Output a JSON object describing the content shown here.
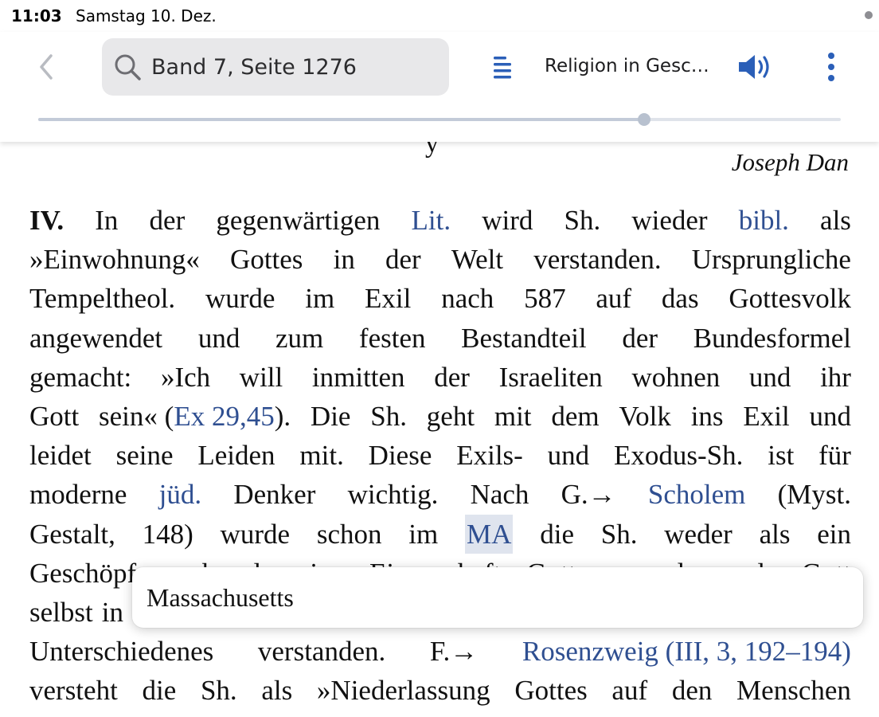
{
  "status_bar": {
    "time": "11:03",
    "date": "Samstag 10. Dez."
  },
  "toolbar": {
    "back_icon": "chevron-left-icon",
    "search": {
      "icon": "search-icon",
      "value": "Band 7, Seite 1276"
    },
    "toc_icon": "list-icon",
    "book_title": "Religion in Gesc…",
    "speaker_icon": "speaker-icon",
    "more_icon": "more-vertical-icon",
    "progress": 0.755
  },
  "page": {
    "cutoff_text": "y",
    "author": "Joseph Dan",
    "lines": [
      [
        {
          "text": "IV.",
          "type": "bold"
        },
        {
          "text": "In",
          "type": "text"
        },
        {
          "text": "der",
          "type": "text"
        },
        {
          "text": "gegenwärtigen",
          "type": "text"
        },
        {
          "text": "Lit.",
          "type": "link"
        },
        {
          "text": "wird",
          "type": "text"
        },
        {
          "text": "Sh.",
          "type": "text"
        },
        {
          "text": "wieder",
          "type": "text"
        },
        {
          "text": "bibl.",
          "type": "link"
        },
        {
          "text": "als",
          "type": "text"
        }
      ],
      [
        {
          "text": "»Einwohnung«",
          "type": "text"
        },
        {
          "text": "Gottes",
          "type": "text"
        },
        {
          "text": "in",
          "type": "text"
        },
        {
          "text": "der",
          "type": "text"
        },
        {
          "text": "Welt",
          "type": "text"
        },
        {
          "text": "verstanden.",
          "type": "text"
        },
        {
          "text": "Ursprungliche",
          "type": "text"
        }
      ],
      [
        {
          "text": "Tempeltheol.",
          "type": "text"
        },
        {
          "text": "wurde",
          "type": "text"
        },
        {
          "text": "im",
          "type": "text"
        },
        {
          "text": "Exil",
          "type": "text"
        },
        {
          "text": "nach",
          "type": "text"
        },
        {
          "text": "587",
          "type": "text"
        },
        {
          "text": "auf",
          "type": "text"
        },
        {
          "text": "das",
          "type": "text"
        },
        {
          "text": "Gottesvolk",
          "type": "text"
        }
      ],
      [
        {
          "text": "angewendet",
          "type": "text"
        },
        {
          "text": "und",
          "type": "text"
        },
        {
          "text": "zum",
          "type": "text"
        },
        {
          "text": "festen",
          "type": "text"
        },
        {
          "text": "Bestandteil",
          "type": "text"
        },
        {
          "text": "der",
          "type": "text"
        },
        {
          "text": "Bundesformel",
          "type": "text"
        }
      ],
      [
        {
          "text": "gemacht:",
          "type": "text"
        },
        {
          "text": "»Ich",
          "type": "text"
        },
        {
          "text": "will",
          "type": "text"
        },
        {
          "text": "inmitten",
          "type": "text"
        },
        {
          "text": "der",
          "type": "text"
        },
        {
          "text": "Israeliten",
          "type": "text"
        },
        {
          "text": "wohnen",
          "type": "text"
        },
        {
          "text": "und",
          "type": "text"
        },
        {
          "text": "ihr",
          "type": "text"
        }
      ],
      [
        {
          "text": "Gott",
          "type": "text"
        },
        {
          "text": "sein« (",
          "type": "text"
        },
        {
          "text": "Ex 29,45",
          "type": "link",
          "attach": true
        },
        {
          "text": ").",
          "type": "text",
          "attach": true
        },
        {
          "text": "Die",
          "type": "text"
        },
        {
          "text": "Sh.",
          "type": "text"
        },
        {
          "text": "geht",
          "type": "text"
        },
        {
          "text": "mit",
          "type": "text"
        },
        {
          "text": "dem",
          "type": "text"
        },
        {
          "text": "Volk",
          "type": "text"
        },
        {
          "text": "ins",
          "type": "text"
        },
        {
          "text": "Exil",
          "type": "text"
        },
        {
          "text": "und",
          "type": "text"
        }
      ],
      [
        {
          "text": "leidet",
          "type": "text"
        },
        {
          "text": "seine",
          "type": "text"
        },
        {
          "text": "Leiden",
          "type": "text"
        },
        {
          "text": "mit.",
          "type": "text"
        },
        {
          "text": "Diese",
          "type": "text"
        },
        {
          "text": "Exils-",
          "type": "text"
        },
        {
          "text": "und",
          "type": "text"
        },
        {
          "text": "Exodus-Sh.",
          "type": "text"
        },
        {
          "text": "ist",
          "type": "text"
        },
        {
          "text": "für",
          "type": "text"
        }
      ],
      [
        {
          "text": "moderne",
          "type": "text"
        },
        {
          "text": "jüd.",
          "type": "link"
        },
        {
          "text": "Denker",
          "type": "text"
        },
        {
          "text": "wichtig.",
          "type": "text"
        },
        {
          "text": "Nach",
          "type": "text"
        },
        {
          "text": "G.→",
          "type": "text"
        },
        {
          "text": "Scholem",
          "type": "link"
        },
        {
          "text": "(Myst.",
          "type": "text"
        }
      ],
      [
        {
          "text": "Gestalt,",
          "type": "text"
        },
        {
          "text": "148)",
          "type": "text"
        },
        {
          "text": "wurde",
          "type": "text"
        },
        {
          "text": "schon",
          "type": "text"
        },
        {
          "text": "im",
          "type": "text"
        },
        {
          "text": "MA",
          "type": "link-highlight"
        },
        {
          "text": "die",
          "type": "text"
        },
        {
          "text": "Sh.",
          "type": "text"
        },
        {
          "text": "weder",
          "type": "text"
        },
        {
          "text": "als",
          "type": "text"
        },
        {
          "text": "ein",
          "type": "text"
        }
      ],
      [
        {
          "text": "Geschöpf",
          "type": "text"
        },
        {
          "text": "noch",
          "type": "text"
        },
        {
          "text": "als",
          "type": "text"
        },
        {
          "text": "eine",
          "type": "text"
        },
        {
          "text": "Eigenschaft",
          "type": "text"
        },
        {
          "text": "Gottes,",
          "type": "text"
        },
        {
          "text": "sondern",
          "type": "text"
        },
        {
          "text": "als",
          "type": "text"
        },
        {
          "text": "Gott",
          "type": "text"
        }
      ],
      [
        {
          "text": "selbst",
          "type": "text"
        },
        {
          "text": "in",
          "type": "text"
        }
      ],
      [
        {
          "text": "Unterschiedenes",
          "type": "text"
        },
        {
          "text": "verstanden.",
          "type": "text"
        },
        {
          "text": "F.→",
          "type": "text"
        },
        {
          "text": "Rosenzweig (III, 3, 192–194)",
          "type": "link"
        }
      ],
      [
        {
          "text": "versteht",
          "type": "text"
        },
        {
          "text": "die",
          "type": "text"
        },
        {
          "text": "Sh.",
          "type": "text"
        },
        {
          "text": "als",
          "type": "text"
        },
        {
          "text": "»Niederlassung",
          "type": "text"
        },
        {
          "text": "Gottes",
          "type": "text"
        },
        {
          "text": "auf",
          "type": "text"
        },
        {
          "text": "den",
          "type": "text"
        },
        {
          "text": "Menschen",
          "type": "text"
        }
      ]
    ]
  },
  "tooltip": {
    "text": "Massachusetts"
  },
  "colors": {
    "accent": "#2b5fb8",
    "link": "#2f4f91",
    "highlight": "#dfe4ee",
    "search_bg": "#e8e8ea"
  }
}
